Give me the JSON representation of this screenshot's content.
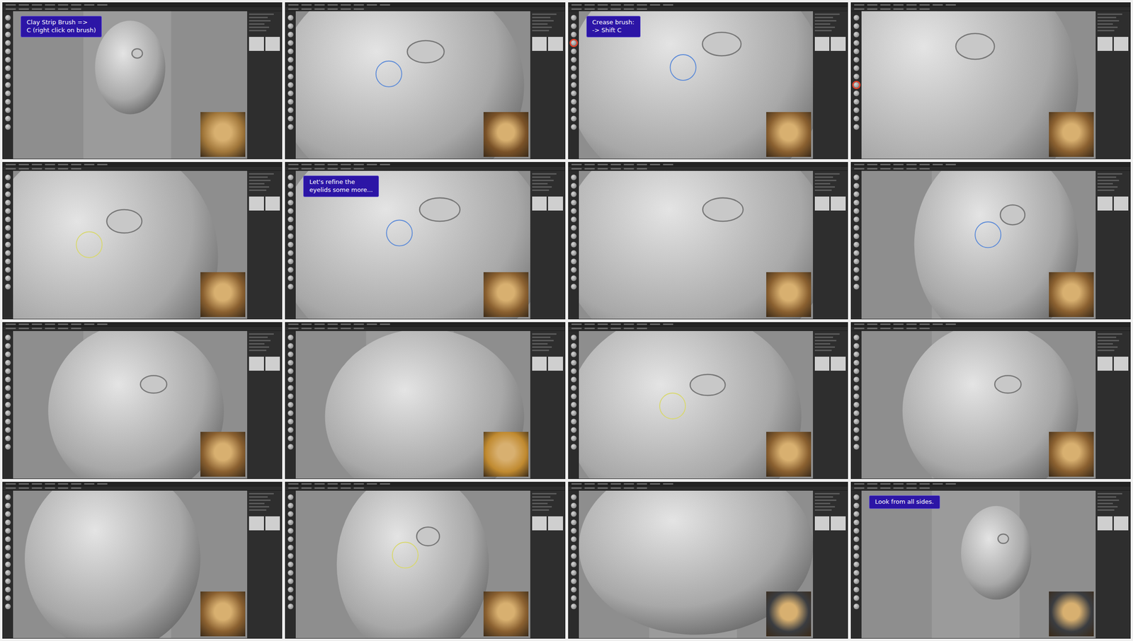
{
  "panels": [
    {
      "caption": [
        "Clay Strip Brush =>",
        "C (right click on brush)"
      ],
      "brush_ring": {
        "on": false,
        "color": "#5b8ad8"
      },
      "tool_highlight": {
        "on": false,
        "index": 0
      },
      "reference_color": "#a0763a"
    },
    {
      "caption": [],
      "brush_ring": {
        "on": true,
        "color": "#5b8ad8"
      },
      "tool_highlight": {
        "on": false,
        "index": 0
      },
      "reference_color": "#7a5228"
    },
    {
      "caption": [
        "Crease brush:",
        "-> Shift C"
      ],
      "brush_ring": {
        "on": true,
        "color": "#5b8ad8"
      },
      "tool_highlight": {
        "on": true,
        "index": 3
      },
      "reference_color": "#8a6030"
    },
    {
      "caption": [],
      "brush_ring": {
        "on": false,
        "color": "#5b8ad8"
      },
      "tool_highlight": {
        "on": true,
        "index": 8
      },
      "reference_color": "#8a6030"
    },
    {
      "caption": [],
      "brush_ring": {
        "on": true,
        "color": "#d8d870"
      },
      "tool_highlight": {
        "on": false,
        "index": 0
      },
      "reference_color": "#8a6030"
    },
    {
      "caption": [
        "Let's refine the",
        "eyelids some more..."
      ],
      "brush_ring": {
        "on": true,
        "color": "#5b8ad8"
      },
      "tool_highlight": {
        "on": false,
        "index": 0
      },
      "reference_color": "#8a6030"
    },
    {
      "caption": [],
      "brush_ring": {
        "on": false,
        "color": "#5b8ad8"
      },
      "tool_highlight": {
        "on": false,
        "index": 0
      },
      "reference_color": "#8a6030"
    },
    {
      "caption": [],
      "brush_ring": {
        "on": true,
        "color": "#5b8ad8"
      },
      "tool_highlight": {
        "on": false,
        "index": 0
      },
      "reference_color": "#8a6030"
    },
    {
      "caption": [],
      "brush_ring": {
        "on": false,
        "color": "#5b8ad8"
      },
      "tool_highlight": {
        "on": false,
        "index": 0
      },
      "reference_color": "#8a6030"
    },
    {
      "caption": [],
      "brush_ring": {
        "on": false,
        "color": "#5b8ad8"
      },
      "tool_highlight": {
        "on": false,
        "index": 0
      },
      "reference_color": "#c08a30"
    },
    {
      "caption": [],
      "brush_ring": {
        "on": true,
        "color": "#d8d870"
      },
      "tool_highlight": {
        "on": false,
        "index": 0
      },
      "reference_color": "#8a6030"
    },
    {
      "caption": [],
      "brush_ring": {
        "on": false,
        "color": "#5b8ad8"
      },
      "tool_highlight": {
        "on": false,
        "index": 0
      },
      "reference_color": "#8a6030"
    },
    {
      "caption": [],
      "brush_ring": {
        "on": false,
        "color": "#5b8ad8"
      },
      "tool_highlight": {
        "on": false,
        "index": 0
      },
      "reference_color": "#8a6030"
    },
    {
      "caption": [],
      "brush_ring": {
        "on": true,
        "color": "#d8d870"
      },
      "tool_highlight": {
        "on": false,
        "index": 0
      },
      "reference_color": "#8a6030"
    },
    {
      "caption": [],
      "brush_ring": {
        "on": false,
        "color": "#5b8ad8"
      },
      "tool_highlight": {
        "on": false,
        "index": 0
      },
      "reference_color": "#3a3c40"
    },
    {
      "caption": [
        "Look from all sides."
      ],
      "brush_ring": {
        "on": false,
        "color": "#5b8ad8"
      },
      "tool_highlight": {
        "on": false,
        "index": 0
      },
      "reference_color": "#3a3c40"
    }
  ]
}
